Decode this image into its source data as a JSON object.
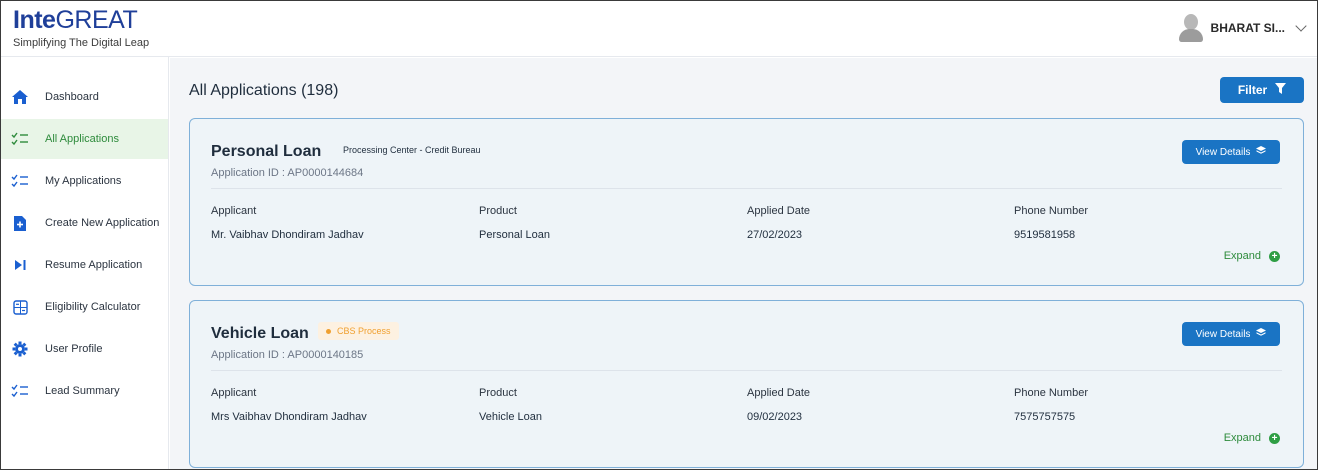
{
  "header": {
    "logo_bold": "Inte",
    "logo_light": "GREAT",
    "tagline": "Simplifying The Digital Leap",
    "user_name": "BHARAT SI..."
  },
  "sidebar": {
    "items": [
      {
        "label": "Dashboard",
        "icon": "home-icon"
      },
      {
        "label": "All Applications",
        "icon": "checklist-icon"
      },
      {
        "label": "My Applications",
        "icon": "checklist-icon"
      },
      {
        "label": "Create New Application",
        "icon": "file-plus-icon"
      },
      {
        "label": "Resume Application",
        "icon": "play-next-icon"
      },
      {
        "label": "Eligibility Calculator",
        "icon": "calculator-icon"
      },
      {
        "label": "User Profile",
        "icon": "gear-icon"
      },
      {
        "label": "Lead Summary",
        "icon": "checklist-icon"
      }
    ],
    "active_index": 1
  },
  "main": {
    "title": "All Applications (198)",
    "filter_label": "Filter",
    "columns": {
      "applicant": "Applicant",
      "product": "Product",
      "applied_date": "Applied Date",
      "phone": "Phone Number"
    },
    "view_details_label": "View Details",
    "expand_label": "Expand",
    "applications": [
      {
        "title": "Personal Loan",
        "tag": "Processing Center - Credit Bureau",
        "badge": "",
        "app_id": "Application ID : AP0000144684",
        "applicant": "Mr. Vaibhav Dhondiram Jadhav",
        "product": "Personal Loan",
        "applied_date": "27/02/2023",
        "phone": "9519581958"
      },
      {
        "title": "Vehicle Loan",
        "tag": "",
        "badge": "CBS Process",
        "app_id": "Application ID : AP0000140185",
        "applicant": "Mrs Vaibhav Dhondiram Jadhav",
        "product": "Vehicle Loan",
        "applied_date": "09/02/2023",
        "phone": "7575757575"
      }
    ]
  },
  "colors": {
    "brand_blue": "#1a74c4",
    "logo_blue": "#1f3f99",
    "active_green": "#2e8b3c",
    "badge_orange": "#f0a030",
    "card_bg": "#eef4f8",
    "card_border": "#7fb0d9"
  }
}
